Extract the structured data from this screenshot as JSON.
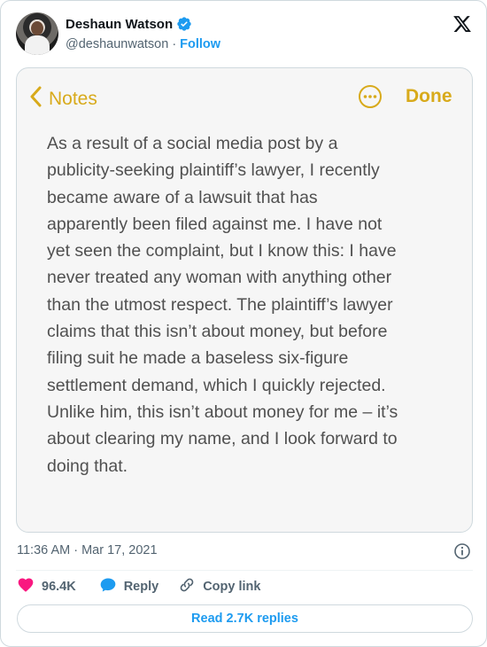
{
  "author": {
    "display_name": "Deshaun Watson",
    "handle": "@deshaunwatson",
    "separator": "·",
    "follow_label": "Follow"
  },
  "media": {
    "app": "Notes",
    "back_label": "Notes",
    "done_label": "Done",
    "accent_color": "#d8aa1b",
    "note_text": "As a result of a social media post by a\npublicity-seeking plaintiff’s lawyer, I recently\nbecame aware of a lawsuit that has\napparently been filed against me.  I have not\nyet seen the complaint, but I know this: I have\nnever treated any woman with anything other\nthan the utmost respect.  The plaintiff’s lawyer\nclaims that this isn’t about money, but before\nfiling suit he made a baseless six-figure\nsettlement demand, which I quickly rejected.\n Unlike him, this isn’t about money for me – it’s\nabout clearing my name, and I look forward to\ndoing that."
  },
  "meta": {
    "timestamp": "11:36 AM · Mar 17, 2021"
  },
  "actions": {
    "like_count": "96.4K",
    "reply_label": "Reply",
    "copy_link_label": "Copy link"
  },
  "footer": {
    "read_replies_label": "Read 2.7K replies"
  },
  "colors": {
    "link_blue": "#1d9bf0",
    "like_pink": "#f91880",
    "muted_text": "#536471"
  },
  "icons": [
    "verified-badge-icon",
    "x-logo-icon",
    "chevron-left-icon",
    "more-options-icon",
    "info-icon",
    "heart-icon",
    "reply-bubble-icon",
    "link-icon"
  ]
}
